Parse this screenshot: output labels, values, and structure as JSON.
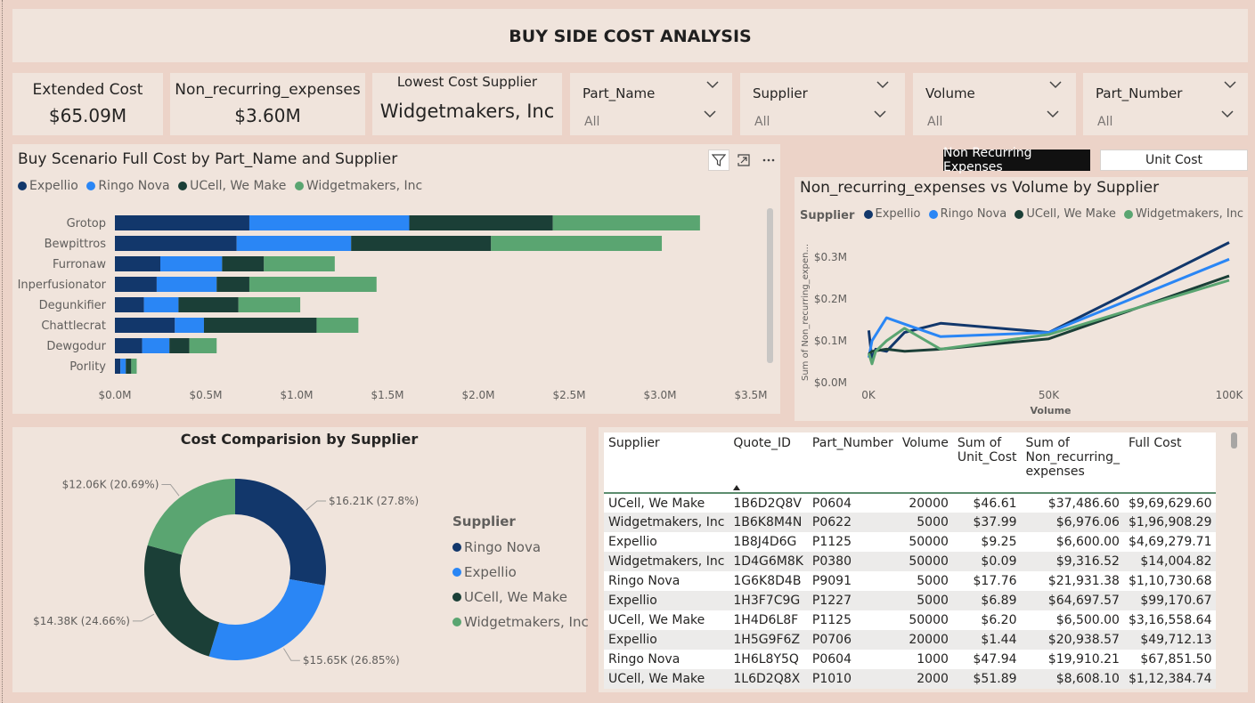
{
  "header": {
    "title": "BUY SIDE COST ANALYSIS"
  },
  "kpis": [
    {
      "label": "Extended Cost",
      "value": "$65.09M"
    },
    {
      "label": "Non_recurring_expenses",
      "value": "$3.60M"
    },
    {
      "label": "Lowest Cost Supplier",
      "value": "Widgetmakers, Inc"
    }
  ],
  "slicers": [
    {
      "title": "Part_Name",
      "value": "All"
    },
    {
      "title": "Supplier",
      "value": "All"
    },
    {
      "title": "Volume",
      "value": "All"
    },
    {
      "title": "Part_Number",
      "value": "All"
    }
  ],
  "toggles": {
    "active": "Non Recurring Expenses",
    "inactive": "Unit Cost"
  },
  "colors": {
    "Expellio": "#12376b",
    "Ringo Nova": "#2a86f5",
    "UCell, We Make": "#1b3f37",
    "Widgetmakers, Inc": "#5aa571",
    "panel": "#f0e4dc",
    "background": "#ecd3c8"
  },
  "icons": [
    "filter-icon",
    "focus-mode-icon",
    "more-options-icon",
    "chevron-down-icon",
    "sort-ascending-icon"
  ],
  "chart_data": [
    {
      "type": "bar",
      "orientation": "horizontal",
      "stacked": true,
      "title": "Buy Scenario Full Cost by Part_Name and Supplier",
      "categories": [
        "Grotop",
        "Bewpittros",
        "Furronaw",
        "Inperfusionator",
        "Degunkifier",
        "Chattlecrat",
        "Dewgodur",
        "Porlity"
      ],
      "series": [
        {
          "name": "Expellio",
          "values": [
            0.74,
            0.67,
            0.25,
            0.23,
            0.16,
            0.33,
            0.15,
            0.03
          ]
        },
        {
          "name": "Ringo Nova",
          "values": [
            0.88,
            0.63,
            0.34,
            0.33,
            0.19,
            0.16,
            0.15,
            0.03
          ]
        },
        {
          "name": "UCell, We Make",
          "values": [
            0.79,
            0.77,
            0.23,
            0.18,
            0.33,
            0.62,
            0.11,
            0.03
          ]
        },
        {
          "name": "Widgetmakers, Inc",
          "values": [
            0.81,
            0.94,
            0.39,
            0.7,
            0.34,
            0.23,
            0.15,
            0.03
          ]
        }
      ],
      "xticks": [
        "$0.0M",
        "$0.5M",
        "$1.0M",
        "$1.5M",
        "$2.0M",
        "$2.5M",
        "$3.0M",
        "$3.5M"
      ],
      "xlim": [
        0,
        3.5
      ],
      "legend": "top-left"
    },
    {
      "type": "line",
      "title": "Non_recurring_expenses vs Volume by Supplier",
      "legend_title": "Supplier",
      "xlabel": "Volume",
      "ylabel": "Sum of Non_recurring_expen...",
      "xticks": [
        "0K",
        "50K",
        "100K"
      ],
      "yticks": [
        "$0.0M",
        "$0.1M",
        "$0.2M",
        "$0.3M"
      ],
      "xlim": [
        0,
        100000
      ],
      "ylim": [
        0,
        0.3
      ],
      "series": [
        {
          "name": "Expellio",
          "points": [
            [
              100,
              0.125
            ],
            [
              1000,
              0.055
            ],
            [
              2000,
              0.08
            ],
            [
              5000,
              0.075
            ],
            [
              10000,
              0.12
            ],
            [
              20000,
              0.142
            ],
            [
              50000,
              0.12
            ],
            [
              100000,
              0.335
            ]
          ]
        },
        {
          "name": "Ringo Nova",
          "points": [
            [
              100,
              0.06
            ],
            [
              1000,
              0.1
            ],
            [
              5000,
              0.155
            ],
            [
              10000,
              0.14
            ],
            [
              20000,
              0.11
            ],
            [
              50000,
              0.12
            ],
            [
              100000,
              0.295
            ]
          ]
        },
        {
          "name": "UCell, We Make",
          "points": [
            [
              100,
              0.068
            ],
            [
              1000,
              0.075
            ],
            [
              5000,
              0.08
            ],
            [
              10000,
              0.075
            ],
            [
              20000,
              0.08
            ],
            [
              50000,
              0.105
            ],
            [
              100000,
              0.255
            ]
          ]
        },
        {
          "name": "Widgetmakers, Inc",
          "points": [
            [
              100,
              0.07
            ],
            [
              1000,
              0.045
            ],
            [
              2000,
              0.075
            ],
            [
              5000,
              0.1
            ],
            [
              10000,
              0.13
            ],
            [
              20000,
              0.08
            ],
            [
              50000,
              0.115
            ],
            [
              100000,
              0.245
            ]
          ]
        }
      ],
      "legend": "top-left"
    },
    {
      "type": "pie",
      "donut": true,
      "title": "Cost Comparision by Supplier",
      "legend_title": "Supplier",
      "legend": "right",
      "slices": [
        {
          "name": "Ringo Nova",
          "value": 16.21,
          "label": "$16.21K (27.8%)"
        },
        {
          "name": "Expellio",
          "value": 15.65,
          "label": "$15.65K (26.85%)"
        },
        {
          "name": "UCell, We Make",
          "value": 14.38,
          "label": "$14.38K (24.66%)"
        },
        {
          "name": "Widgetmakers, Inc",
          "value": 12.06,
          "label": "$12.06K (20.69%)"
        }
      ],
      "slice_colors": [
        "#12376b",
        "#2a86f5",
        "#1b3f37",
        "#5aa571"
      ]
    }
  ],
  "table": {
    "columns": [
      "Supplier",
      "Quote_ID",
      "Part_Number",
      "Volume",
      "Sum of Unit_Cost",
      "Sum of Non_recurring_ expenses",
      "Full Cost"
    ],
    "rows": [
      [
        "UCell, We Make",
        "1B6D2Q8V",
        "P0604",
        "20000",
        "$46.61",
        "$37,486.60",
        "$9,69,629.60"
      ],
      [
        "Widgetmakers, Inc",
        "1B6K8M4N",
        "P0622",
        "5000",
        "$37.99",
        "$6,976.06",
        "$1,96,908.29"
      ],
      [
        "Expellio",
        "1B8J4D6G",
        "P1125",
        "50000",
        "$9.25",
        "$6,600.00",
        "$4,69,279.71"
      ],
      [
        "Widgetmakers, Inc",
        "1D4G6M8K",
        "P0380",
        "50000",
        "$0.09",
        "$9,316.52",
        "$14,004.82"
      ],
      [
        "Ringo Nova",
        "1G6K8D4B",
        "P9091",
        "5000",
        "$17.76",
        "$21,931.38",
        "$1,10,730.68"
      ],
      [
        "Expellio",
        "1H3F7C9G",
        "P1227",
        "5000",
        "$6.89",
        "$64,697.57",
        "$99,170.67"
      ],
      [
        "UCell, We Make",
        "1H4D6L8F",
        "P1125",
        "50000",
        "$6.20",
        "$6,500.00",
        "$3,16,558.64"
      ],
      [
        "Expellio",
        "1H5G9F6Z",
        "P0706",
        "20000",
        "$1.44",
        "$20,938.57",
        "$49,712.13"
      ],
      [
        "Ringo Nova",
        "1H6L8Y5Q",
        "P0604",
        "1000",
        "$47.94",
        "$19,910.21",
        "$67,851.50"
      ],
      [
        "UCell, We Make",
        "1L6D2Q8X",
        "P1010",
        "2000",
        "$51.89",
        "$8,608.10",
        "$1,12,384.74"
      ]
    ]
  }
}
